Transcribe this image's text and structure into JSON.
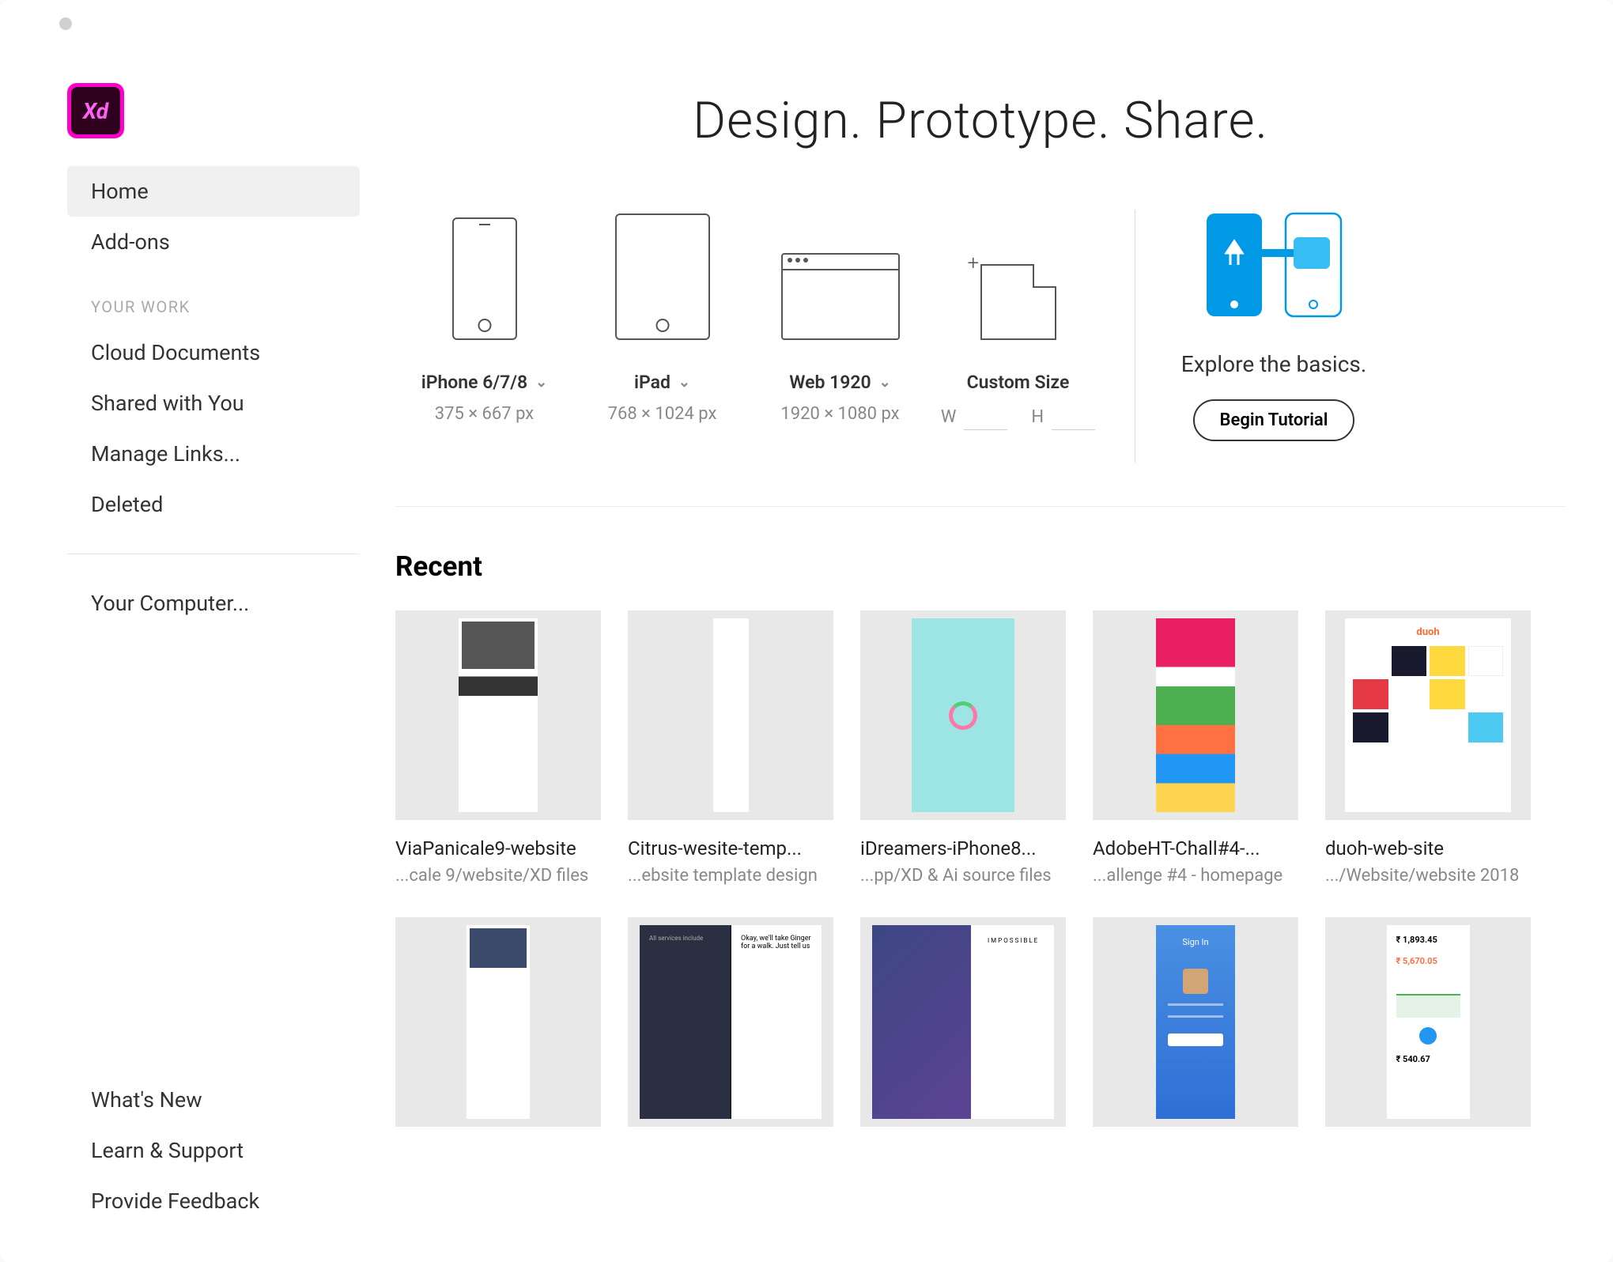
{
  "hero": {
    "title": "Design. Prototype. Share."
  },
  "sidebar": {
    "nav": [
      {
        "label": "Home",
        "active": true
      },
      {
        "label": "Add-ons",
        "active": false
      }
    ],
    "your_work_label": "YOUR WORK",
    "your_work": [
      {
        "label": "Cloud Documents"
      },
      {
        "label": "Shared with You"
      },
      {
        "label": "Manage Links..."
      },
      {
        "label": "Deleted"
      }
    ],
    "computer": {
      "label": "Your Computer..."
    }
  },
  "bottom_nav": [
    {
      "label": "What's New"
    },
    {
      "label": "Learn & Support"
    },
    {
      "label": "Provide Feedback"
    }
  ],
  "presets": [
    {
      "label": "iPhone 6/7/8",
      "dims": "375 × 667 px"
    },
    {
      "label": "iPad",
      "dims": "768 × 1024 px"
    },
    {
      "label": "Web 1920",
      "dims": "1920 × 1080 px"
    }
  ],
  "custom": {
    "label": "Custom Size",
    "w_label": "W",
    "h_label": "H"
  },
  "tutorial": {
    "text": "Explore the basics.",
    "button": "Begin Tutorial"
  },
  "recent": {
    "title": "Recent",
    "items": [
      {
        "name": "ViaPanicale9-website",
        "path": "...cale 9/website/XD files"
      },
      {
        "name": "Citrus-wesite-temp...",
        "path": "...ebsite template design"
      },
      {
        "name": "iDreamers-iPhone8...",
        "path": "...pp/XD & Ai source files"
      },
      {
        "name": "AdobeHT-Chall#4-...",
        "path": "...allenge #4 - homepage"
      },
      {
        "name": "duoh-web-site",
        "path": ".../Website/website 2018"
      },
      {
        "name": "",
        "path": ""
      },
      {
        "name": "",
        "path": ""
      },
      {
        "name": "",
        "path": ""
      },
      {
        "name": "",
        "path": ""
      },
      {
        "name": "",
        "path": ""
      }
    ]
  }
}
